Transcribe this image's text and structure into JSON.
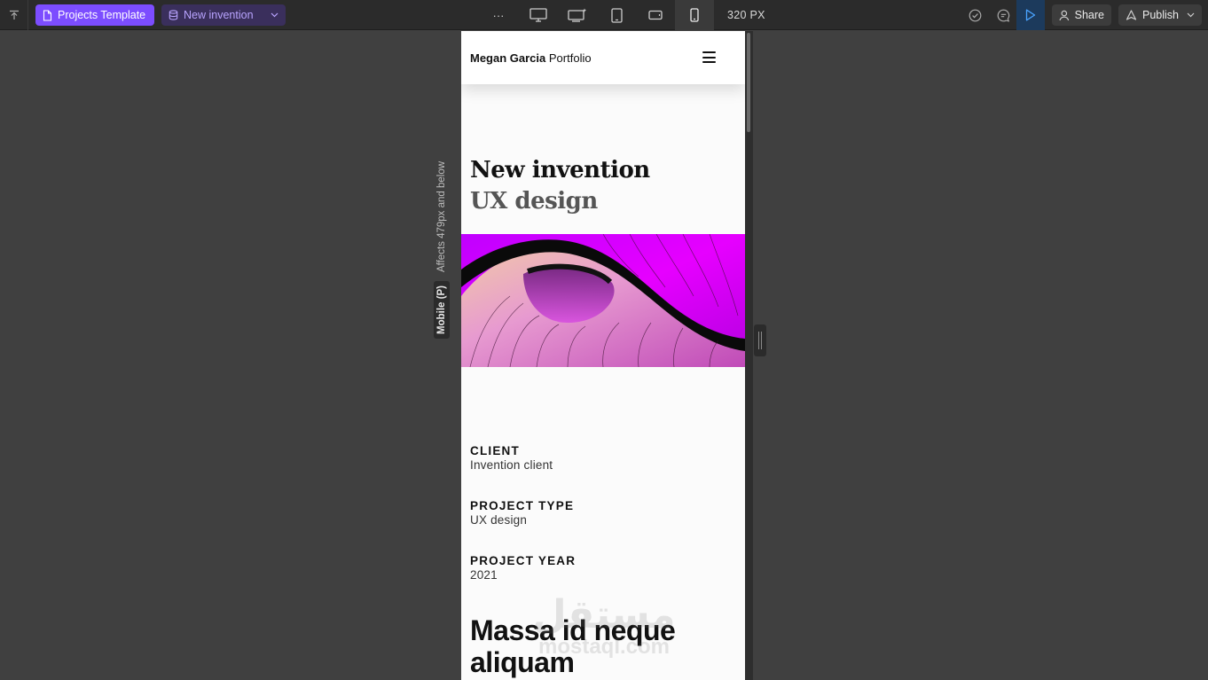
{
  "toolbar": {
    "project_template": "Projects Template",
    "page_select": "New invention",
    "more": "···",
    "width_label": "320 PX",
    "share": "Share",
    "publish": "Publish"
  },
  "breakpoint_label": {
    "tag": "Mobile (P)",
    "note": "Affects 479px and below"
  },
  "site": {
    "brand_name": "Megan Garcia",
    "brand_suffix": "Portfolio",
    "hero_title": "New invention",
    "hero_subtitle": "UX design",
    "meta": [
      {
        "label": "CLIENT",
        "value": "Invention client"
      },
      {
        "label": "PROJECT TYPE",
        "value": "UX design"
      },
      {
        "label": "PROJECT YEAR",
        "value": "2021"
      }
    ],
    "section_title": "Massa id neque aliquam"
  },
  "watermark": {
    "line1": "مستقل",
    "line2": "mostaql.com"
  },
  "colors": {
    "accent": "#7c4dff",
    "hero_magenta": "#e600ff",
    "toolbar_bg": "#2b2b2b",
    "canvas_bg": "#404040"
  }
}
